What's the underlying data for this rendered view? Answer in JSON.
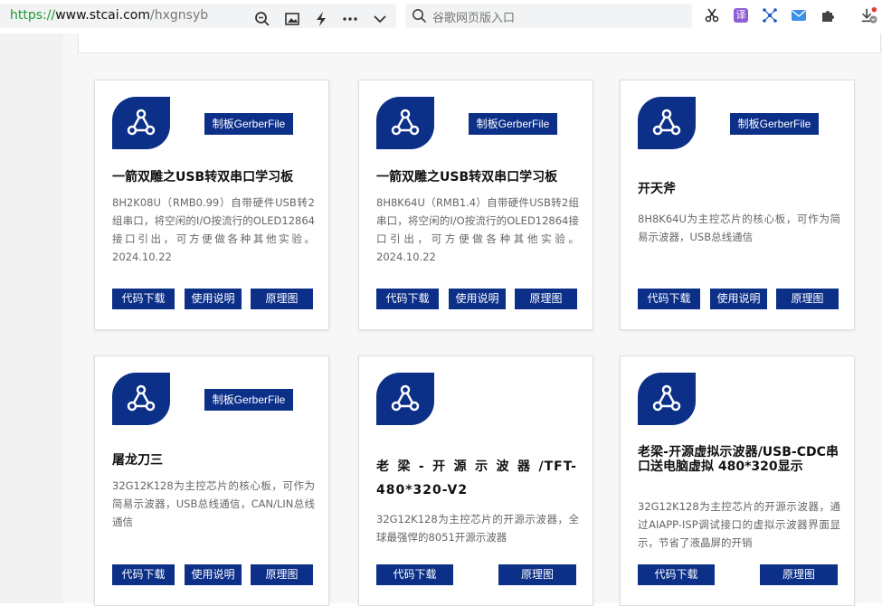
{
  "browser": {
    "url_scheme": "https://",
    "url_domain": "www.stcai.com",
    "url_path": "/hxgnsyb",
    "search_placeholder": "谷歌网页版入口",
    "icons": [
      "zoom-icon",
      "image-icon",
      "bolt-icon",
      "more-icon",
      "chevron-down-icon",
      "search-icon",
      "scissors-icon",
      "translate-icon",
      "network-icon",
      "mail-icon",
      "puzzle-icon",
      "download-icon"
    ],
    "translate_label": "译"
  },
  "colors": {
    "brand": "#0c2f88",
    "url_green": "#1e9b2c"
  },
  "cards": [
    {
      "gerber": "制板GerberFile",
      "title": "一箭双雕之USB转双串口学习板",
      "desc": "8H2K08U（RMB0.99）自带硬件USB转2组串口，将空闲的I/O按流行的OLED12864接口引出，可方便做各种其他实验。2024.10.22",
      "buttons": [
        "代码下载",
        "使用说明",
        "原理图"
      ]
    },
    {
      "gerber": "制板GerberFile",
      "title": "一箭双雕之USB转双串口学习板",
      "desc": "8H8K64U（RMB1.4）自带硬件USB转2组串口，将空闲的I/O按流行的OLED12864接口引出，可方便做各种其他实验。2024.10.22",
      "buttons": [
        "代码下载",
        "使用说明",
        "原理图"
      ]
    },
    {
      "gerber": "制板GerberFile",
      "title": "开天斧",
      "desc": "8H8K64U为主控芯片的核心板，可作为简易示波器，USB总线通信",
      "buttons": [
        "代码下载",
        "使用说明",
        "原理图"
      ]
    },
    {
      "gerber": "制板GerberFile",
      "title": "屠龙刀三",
      "desc": "32G12K128为主控芯片的核心板，可作为简易示波器，USB总线通信，CAN/LIN总线通信",
      "buttons": [
        "代码下载",
        "使用说明",
        "原理图"
      ]
    },
    {
      "title": "老梁-开源示波器/TFT-480*320-V2",
      "desc": "32G12K128为主控芯片的开源示波器，全球最强悍的8051开源示波器",
      "buttons": [
        "代码下载",
        "原理图"
      ]
    },
    {
      "title": "老梁-开源虚拟示波器/USB-CDC串口送电脑虚拟 480*320显示",
      "desc": "32G12K128为主控芯片的开源示波器，通过AIAPP-ISP调试接口的虚拟示波器界面显示，节省了液晶屏的开销",
      "buttons": [
        "代码下载",
        "原理图"
      ]
    }
  ]
}
